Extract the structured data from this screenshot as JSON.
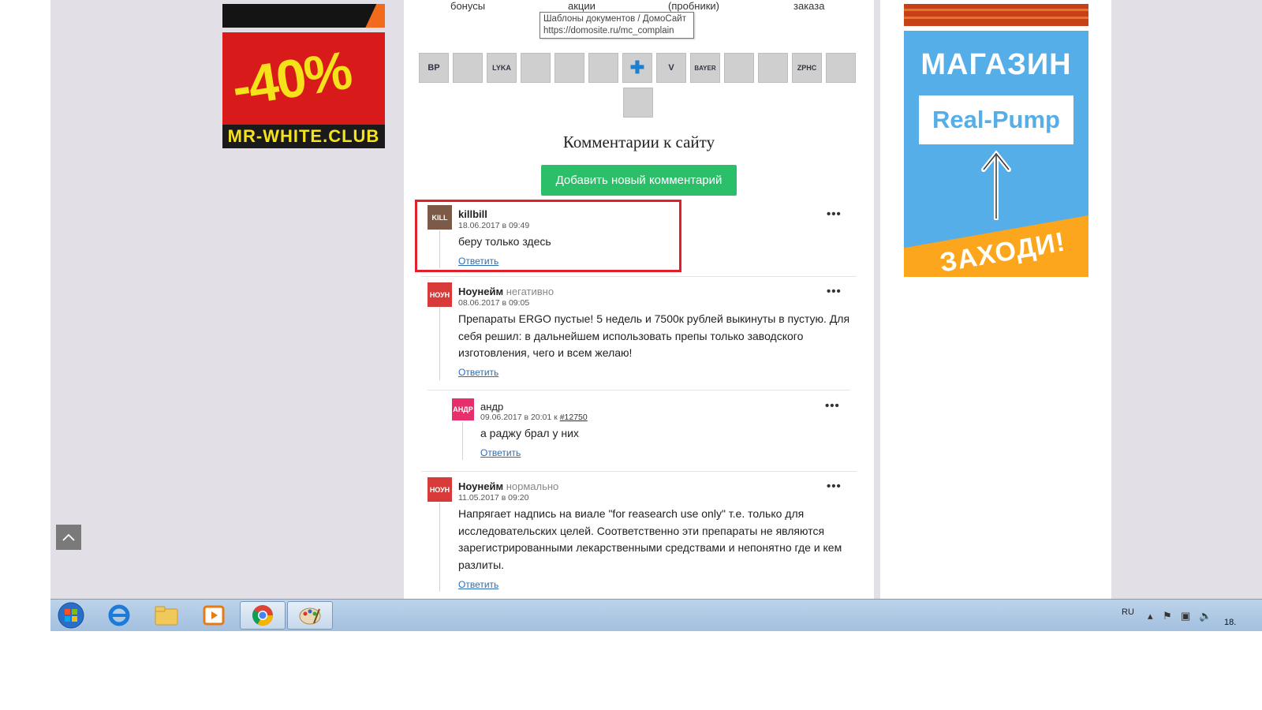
{
  "topnav": [
    "бонусы",
    "акции",
    "(пробники)",
    "заказа"
  ],
  "tooltip": {
    "title": "Шаблоны документов / ДомоСайт",
    "url": "https://domosite.ru/mc_complain"
  },
  "left_ad": {
    "percent": "-40%",
    "site": "MR-WHITE.CLUB"
  },
  "right_ad": {
    "line1": "МАГАЗИН",
    "brand": "Real-Pump",
    "cta": "ЗАХОДИ!"
  },
  "brand_logos": [
    "BP",
    "",
    "LYKA",
    "",
    "",
    "",
    "",
    "V",
    "BAYER",
    "",
    "",
    "ZPHC",
    "",
    ""
  ],
  "comments_section": {
    "title": "Комментарии к сайту",
    "add_button": "Добавить новый комментарий",
    "reply_label": "Ответить",
    "comments": [
      {
        "avatar": "KILL",
        "author": "killbill",
        "mood": "",
        "date": "18.06.2017 в 09:49",
        "ref": "",
        "text": "беру только здесь"
      },
      {
        "avatar": "НОУН",
        "author": "Ноунейм",
        "mood": "негативно",
        "date": "08.06.2017 в 09:05",
        "ref": "",
        "text": "Препараты ERGO пустые! 5 недель и 7500к рублей выкинуты в пустую. Для себя решил: в дальнейшем использовать препы только заводского изготовления, чего и всем желаю!"
      },
      {
        "avatar": "АНДР",
        "author": "андр",
        "mood": "",
        "date": "09.06.2017 в 20:01 к",
        "ref": "#12750",
        "text": "а раджу брал у них"
      },
      {
        "avatar": "НОУН",
        "author": "Ноунейм",
        "mood": "нормально",
        "date": "11.05.2017 в 09:20",
        "ref": "",
        "text": "Напрягает надпись на виале \"for reasearch use only\" т.е. только для исследовательских целей. Соответственно эти препараты не являются зарегистрированными лекарственными средствами и непонятно где и кем разлиты."
      }
    ]
  },
  "taskbar": {
    "lang": "RU",
    "time": "18."
  },
  "icons": {
    "menu": "more-dots-icon",
    "scroll_top": "chevron-up-icon",
    "start": "windows-start-icon",
    "apps": [
      "internet-explorer-icon",
      "file-explorer-icon",
      "media-player-icon",
      "chrome-icon",
      "paint-icon"
    ]
  },
  "colors": {
    "accent_green": "#2cbf6a",
    "highlight_red": "#e0202a",
    "link_blue": "#2a6db5"
  }
}
